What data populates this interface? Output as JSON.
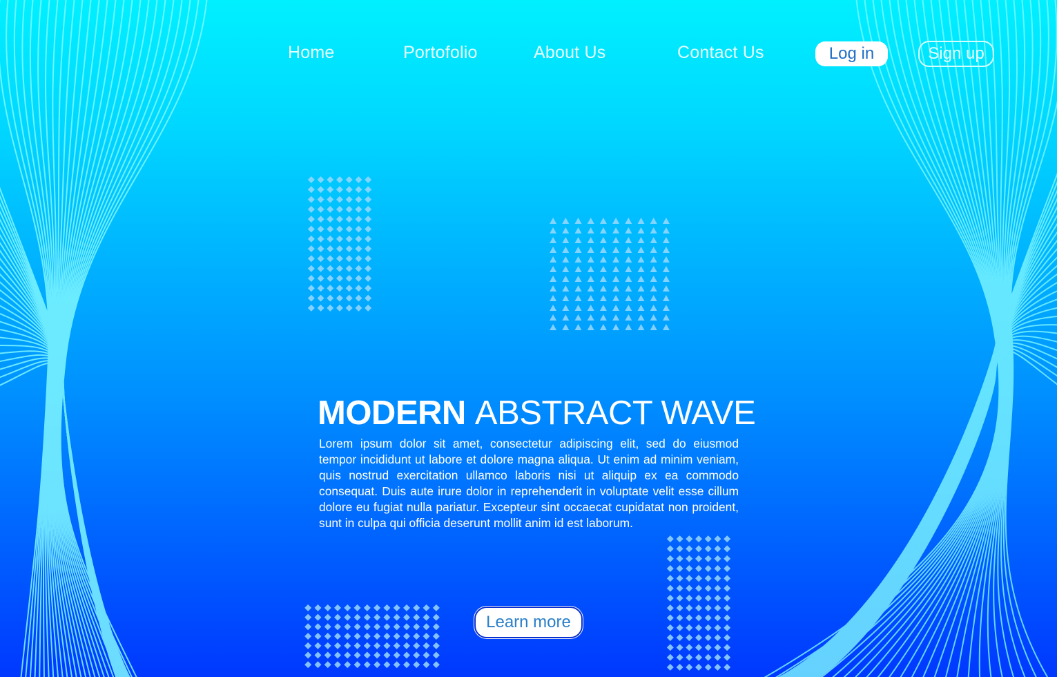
{
  "colors": {
    "gradient_top": "#00f0ff",
    "gradient_bottom": "#0038ff",
    "wave_line": "#7ff8ff",
    "pattern_fill": "#9ad8ff",
    "button_text": "#1f6fc4"
  },
  "nav": {
    "links": [
      {
        "label": "Home"
      },
      {
        "label": "Portofolio"
      },
      {
        "label": "About Us"
      },
      {
        "label": "Contact Us"
      }
    ],
    "login_label": "Log in",
    "signup_label": "Sign up"
  },
  "hero": {
    "title_bold": "MODERN",
    "title_light": "ABSTRACT WAVE",
    "body": "Lorem ipsum dolor sit amet, consectetur adipiscing elit, sed do eiusmod tempor incididunt ut labore et dolore magna aliqua. Ut enim ad minim veniam, quis nostrud exercitation ullamco laboris nisi ut aliquip ex ea commodo consequat. Duis aute irure dolor in reprehenderit in voluptate velit esse cillum dolore eu fugiat nulla pariatur. Excepteur sint occaecat cupidatat non proident, sunt in culpa qui officia deserunt mollit anim id est laborum.",
    "cta_label": "Learn more"
  },
  "decorations": {
    "patterns": [
      {
        "name": "diamond-grid-top-left",
        "shape": "diamond",
        "cols": 7,
        "rows": 14
      },
      {
        "name": "triangle-grid-center",
        "shape": "triangle",
        "cols": 10,
        "rows": 12
      },
      {
        "name": "diamond-grid-bottom-left",
        "shape": "diamond",
        "cols": 14,
        "rows": 7
      },
      {
        "name": "diamond-grid-bottom-right",
        "shape": "diamond",
        "cols": 7,
        "rows": 14
      }
    ]
  }
}
